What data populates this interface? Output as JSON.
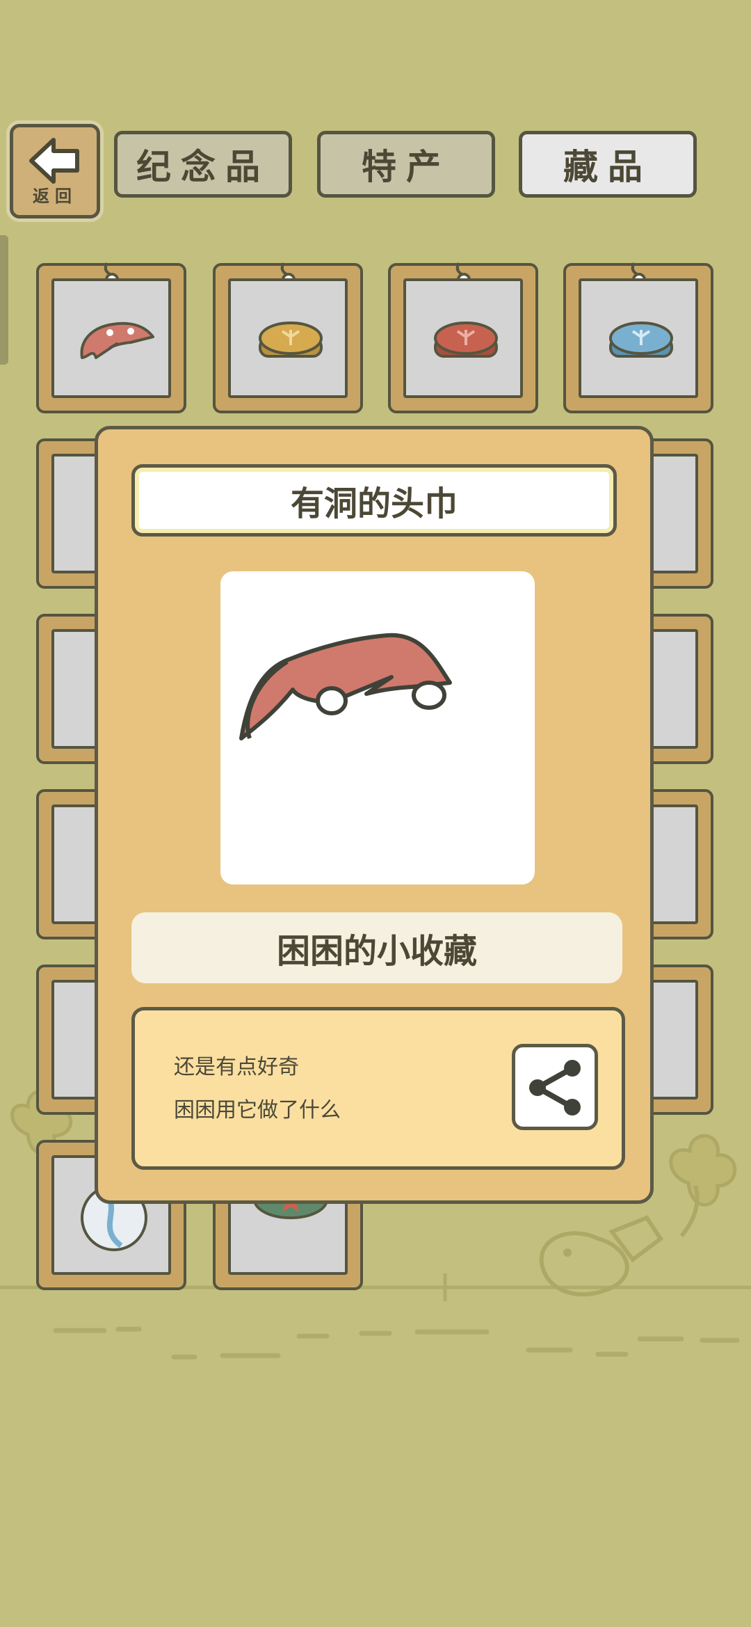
{
  "nav": {
    "back_label": "返回",
    "tabs": [
      {
        "label": "纪念品",
        "active": false
      },
      {
        "label": "特产",
        "active": false
      },
      {
        "label": "藏品",
        "active": true
      }
    ]
  },
  "grid": {
    "items": [
      {
        "name": "hole-bandana",
        "color": "#d07a6d"
      },
      {
        "name": "yellow-charm",
        "color": "#d6aa4e"
      },
      {
        "name": "red-charm",
        "color": "#c86250"
      },
      {
        "name": "blue-charm",
        "color": "#7ab0cf"
      }
    ]
  },
  "modal": {
    "item_name": "有洞的头巾",
    "category": "困困的小收藏",
    "description_lines": [
      "还是有点好奇",
      "困困用它做了什么"
    ]
  },
  "colors": {
    "background": "#c3c07f",
    "card_wood": "#c9a565",
    "modal_bg": "#e8c37f",
    "bandana_red": "#d07a6d",
    "outline": "#555540"
  }
}
